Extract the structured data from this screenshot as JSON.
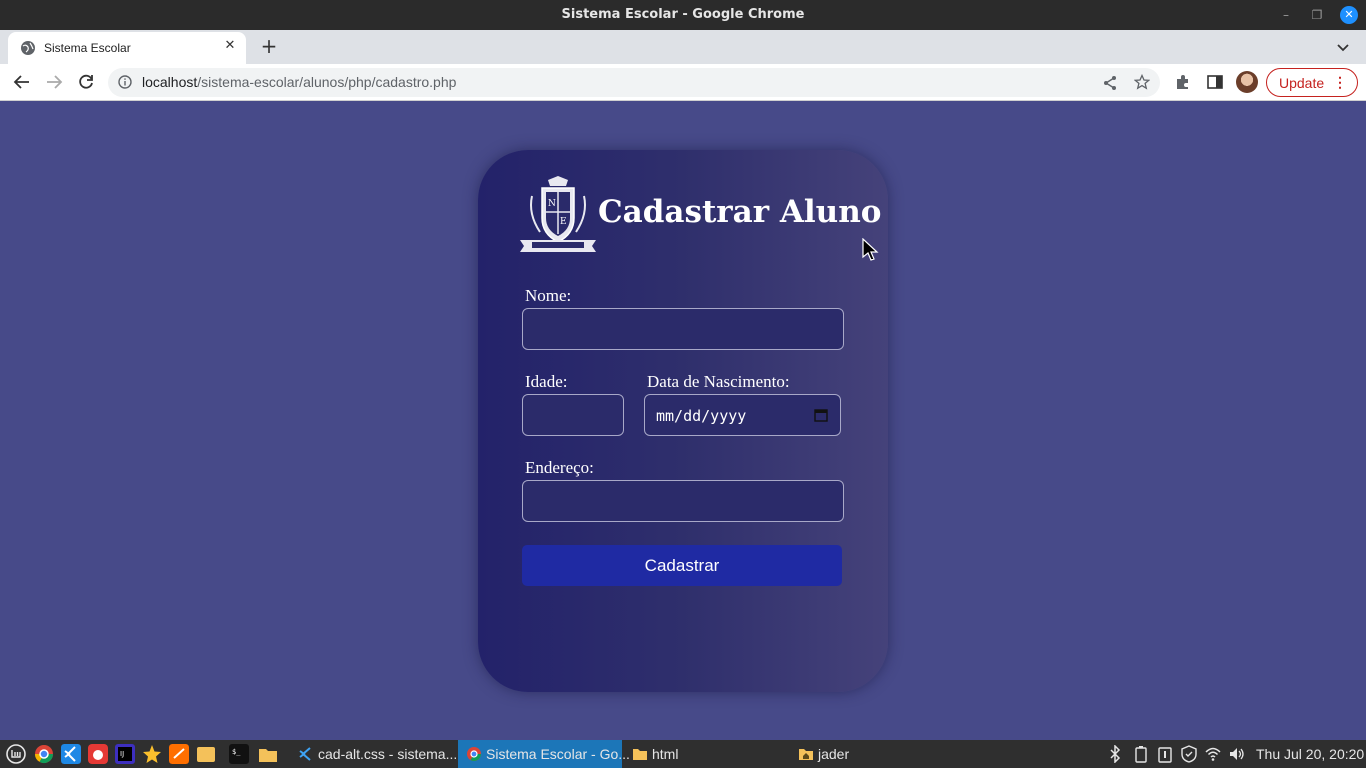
{
  "window": {
    "title": "Sistema Escolar - Google Chrome"
  },
  "tab": {
    "label": "Sistema Escolar"
  },
  "address_bar": {
    "host": "localhost",
    "path": "/sistema-escolar/alunos/php/cadastro.php"
  },
  "toolbar": {
    "update_label": "Update"
  },
  "form": {
    "title": "Cadastrar Aluno",
    "logo_icon": "school-crest-icon",
    "nome_label": "Nome:",
    "idade_label": "Idade:",
    "data_label": "Data de Nascimento:",
    "data_placeholder": "mm/dd/yyyy",
    "endereco_label": "Endereço:",
    "submit_label": "Cadastrar"
  },
  "taskbar": {
    "tasks": [
      {
        "label": "cad-alt.css - sistema...",
        "icon": "vscode-icon"
      },
      {
        "label": "Sistema Escolar - Go...",
        "icon": "chrome-icon"
      },
      {
        "label": "html",
        "icon": "folder-icon"
      },
      {
        "label": "jader",
        "icon": "folder-home-icon"
      }
    ],
    "clock": "Thu Jul 20, 20:20"
  },
  "colors": {
    "page_bg": "#474a89",
    "card_gradient_start": "#23226a",
    "card_gradient_end": "#45427a",
    "button_bg": "#1f2aa3",
    "update_accent": "#c5221f"
  }
}
